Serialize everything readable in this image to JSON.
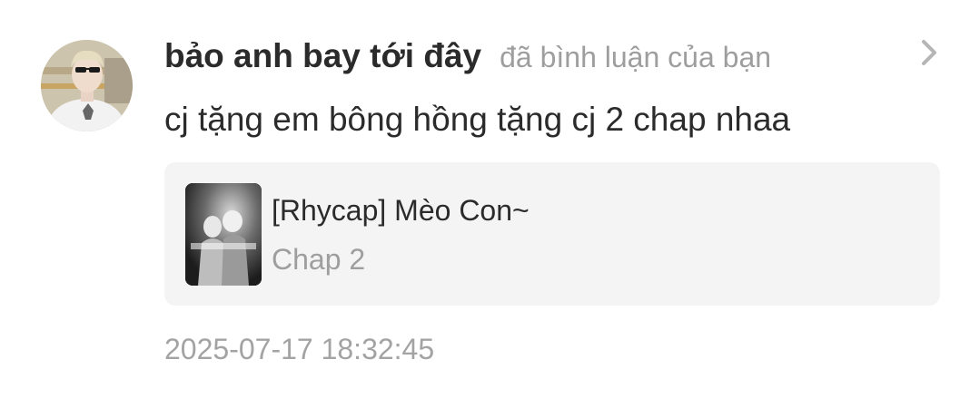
{
  "notification": {
    "user_name": "bảo anh bay tới đây",
    "action": "đã bình luận của bạn",
    "comment": "cj tặng em bông hồng tặng cj 2 chap nhaa",
    "timestamp": "2025-07-17 18:32:45",
    "avatar_icon": "user-avatar-photo",
    "chevron_icon": "chevron-right-icon"
  },
  "card": {
    "title": "[Rhycap] Mèo Con~",
    "chapter": "Chap 2",
    "cover_icon": "story-cover-image"
  },
  "colors": {
    "name_text": "#2b2b2b",
    "secondary_text": "#9e9e9e",
    "card_background": "#f4f4f5",
    "chevron": "#b5b5b5"
  }
}
